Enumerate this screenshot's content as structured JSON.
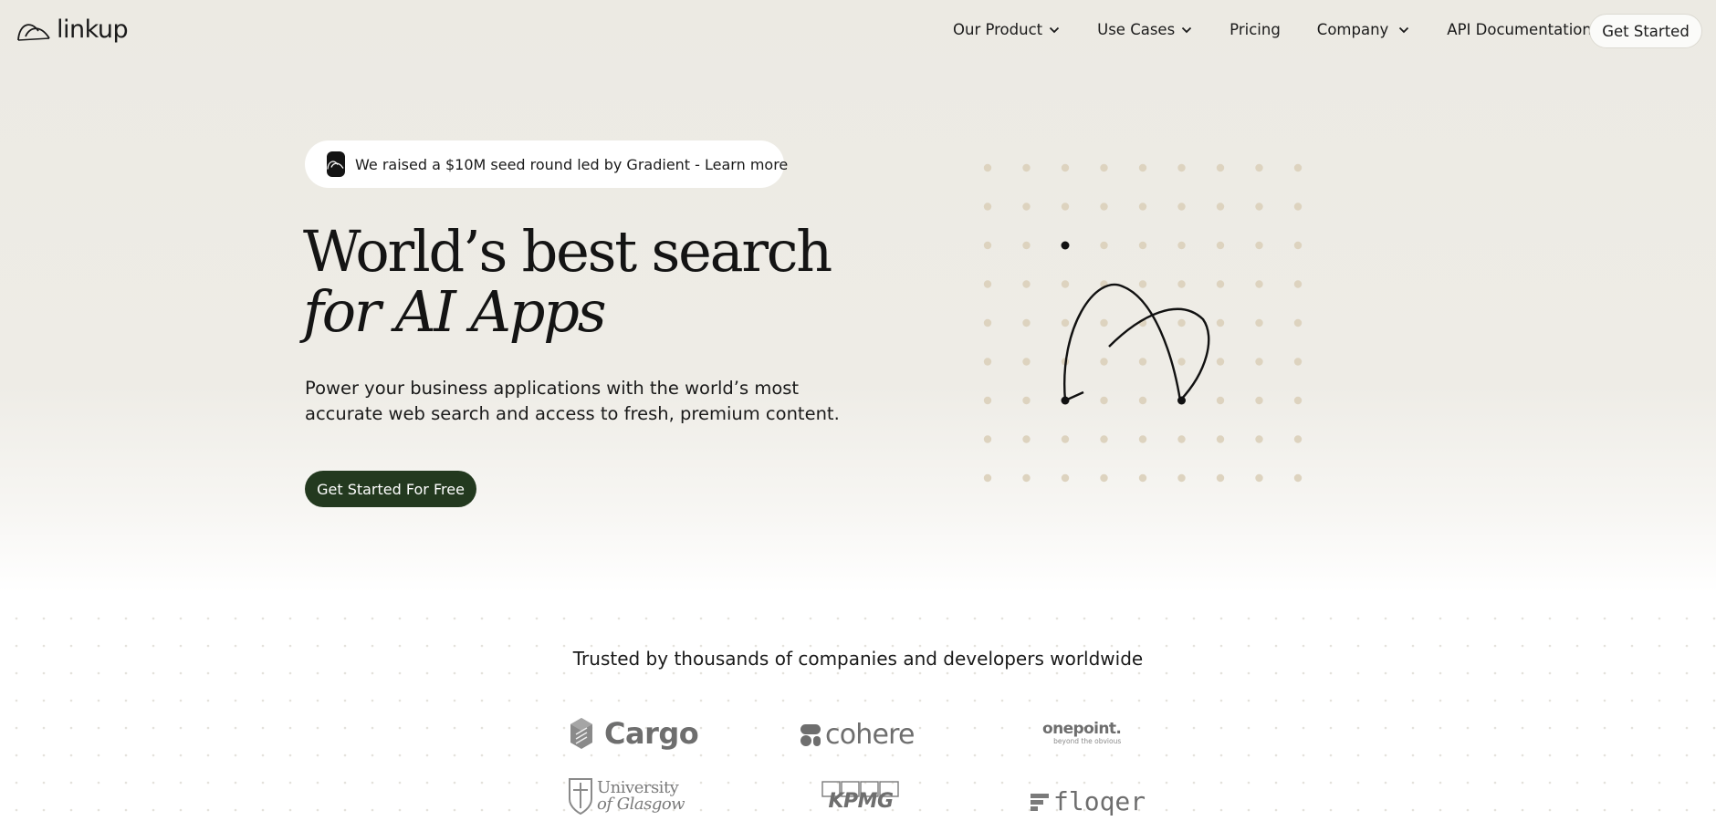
{
  "brand": {
    "name": "linkup",
    "logo_icon": "linkup-arc-icon"
  },
  "nav": {
    "items": [
      {
        "label": "Our Product",
        "has_dropdown": true
      },
      {
        "label": "Use Cases",
        "has_dropdown": true
      },
      {
        "label": "Pricing",
        "has_dropdown": false
      },
      {
        "label": "Company",
        "has_dropdown": true
      },
      {
        "label": "API Documentation",
        "has_dropdown": false
      }
    ],
    "cta": "Get Started"
  },
  "hero": {
    "announcement": "We raised a $10M seed round led by Gradient - Learn more",
    "headline_line1": "World’s best search",
    "headline_line2": "for AI Apps",
    "subtext": "Power your business applications with the world’s most accurate web search and access to fresh, premium content.",
    "cta": "Get Started For Free"
  },
  "trusted": {
    "heading": "Trusted by thousands of companies and developers worldwide",
    "logos": [
      {
        "name": "Cargo"
      },
      {
        "name": "cohere"
      },
      {
        "name": "onepoint.",
        "tagline": "beyond the obvious"
      },
      {
        "name": "University",
        "name2": "of Glasgow"
      },
      {
        "name": "KPMG"
      },
      {
        "name": "floqer"
      }
    ]
  },
  "colors": {
    "background": "#eceae3",
    "primary_button": "#23391f",
    "dot": "#ddd3bf",
    "text": "#141414",
    "logo_gray": "#6f6f6f"
  }
}
